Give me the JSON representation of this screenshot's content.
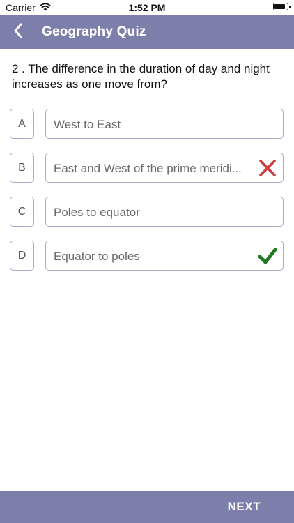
{
  "status_bar": {
    "carrier": "Carrier",
    "time": "1:52 PM",
    "battery_level": 0.9
  },
  "nav": {
    "title": "Geography Quiz",
    "back_icon": "chevron-left-icon"
  },
  "question": {
    "text": "2 . The difference in the duration of day and night increases as one move from?"
  },
  "options": [
    {
      "letter": "A",
      "text": "West to East",
      "mark": ""
    },
    {
      "letter": "B",
      "text": "East and West of the prime meridi...",
      "mark": "wrong"
    },
    {
      "letter": "C",
      "text": "Poles to equator",
      "mark": ""
    },
    {
      "letter": "D",
      "text": "Equator to poles",
      "mark": "correct"
    }
  ],
  "footer": {
    "next_label": "NEXT"
  },
  "colors": {
    "accent": "#7d7fab",
    "option_border": "#a9aad0",
    "wrong": "#d2393e",
    "correct": "#1f7a1f"
  }
}
